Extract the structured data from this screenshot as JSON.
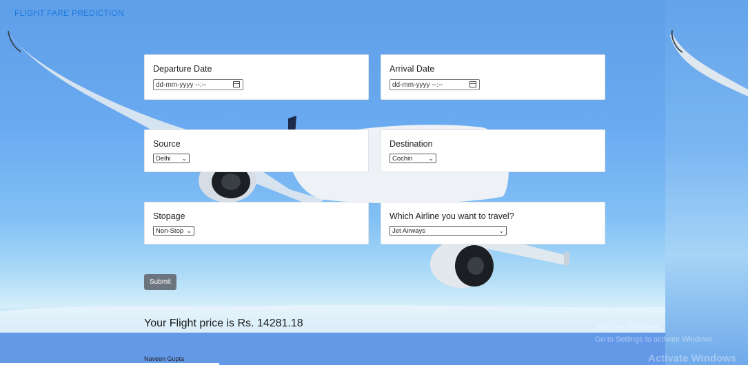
{
  "app": {
    "brand": "FLIGHT FARE PREDICTION"
  },
  "form": {
    "departure": {
      "label": "Departure Date",
      "value": "dd-mm-yyyy --:--"
    },
    "arrival": {
      "label": "Arrival Date",
      "value": "dd-mm-yyyy --:--"
    },
    "source": {
      "label": "Source",
      "selected": "Delhi"
    },
    "destination": {
      "label": "Destination",
      "selected": "Cochin"
    },
    "stopage": {
      "label": "Stopage",
      "selected": "Non-Stop"
    },
    "airline": {
      "label": "Which Airline you want to travel?",
      "selected": "Jet Airways"
    },
    "submit_label": "Submit"
  },
  "result": {
    "text": "Your Flight price is Rs. 14281.18"
  },
  "footer": {
    "author": "Naveen Gupta"
  },
  "watermark": {
    "line1": "Activate Windows",
    "line2": "Go to Settings to activate Windows.",
    "line3": "Activate Windows"
  },
  "icons": {
    "calendar": "calendar-icon",
    "chevron": "chevron-down-icon"
  },
  "colors": {
    "brand": "#1f79e0",
    "submit": "#6c757d",
    "card": "#ffffff"
  }
}
